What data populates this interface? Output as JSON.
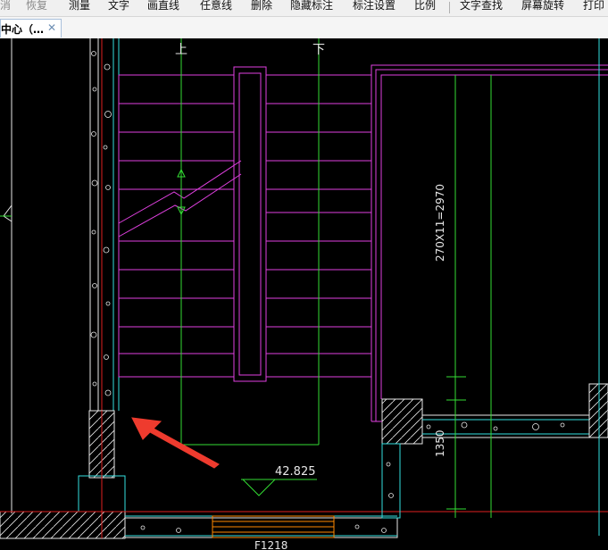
{
  "toolbar": {
    "items": [
      {
        "label": "消",
        "enabled": false
      },
      {
        "label": "恢复",
        "enabled": false
      },
      {
        "label": "测量",
        "enabled": true
      },
      {
        "label": "文字",
        "enabled": true
      },
      {
        "label": "画直线",
        "enabled": true
      },
      {
        "label": "任意线",
        "enabled": true
      },
      {
        "label": "删除",
        "enabled": true
      },
      {
        "label": "隐藏标注",
        "enabled": true
      },
      {
        "label": "标注设置",
        "enabled": true
      },
      {
        "label": "比例",
        "enabled": true
      },
      {
        "label": "文字查找",
        "enabled": true
      },
      {
        "label": "屏幕旋转",
        "enabled": true
      },
      {
        "label": "打印",
        "enabled": true
      }
    ]
  },
  "tab": {
    "label": "中心（…",
    "close": "✕"
  },
  "drawing": {
    "label_up": "上",
    "label_down": "下",
    "stair_dim": "270X11=2970",
    "elevation": "42.825",
    "dim_1350": "1350",
    "dim_bottom": "F1218",
    "colors": {
      "background": "#000000",
      "stair": "#e040e0",
      "axis": "#33dd33",
      "wall": "#33e0e0",
      "red": "#e02020",
      "white": "#ffffff",
      "orange": "#ff8800",
      "arrow": "#ee3b2e"
    }
  }
}
